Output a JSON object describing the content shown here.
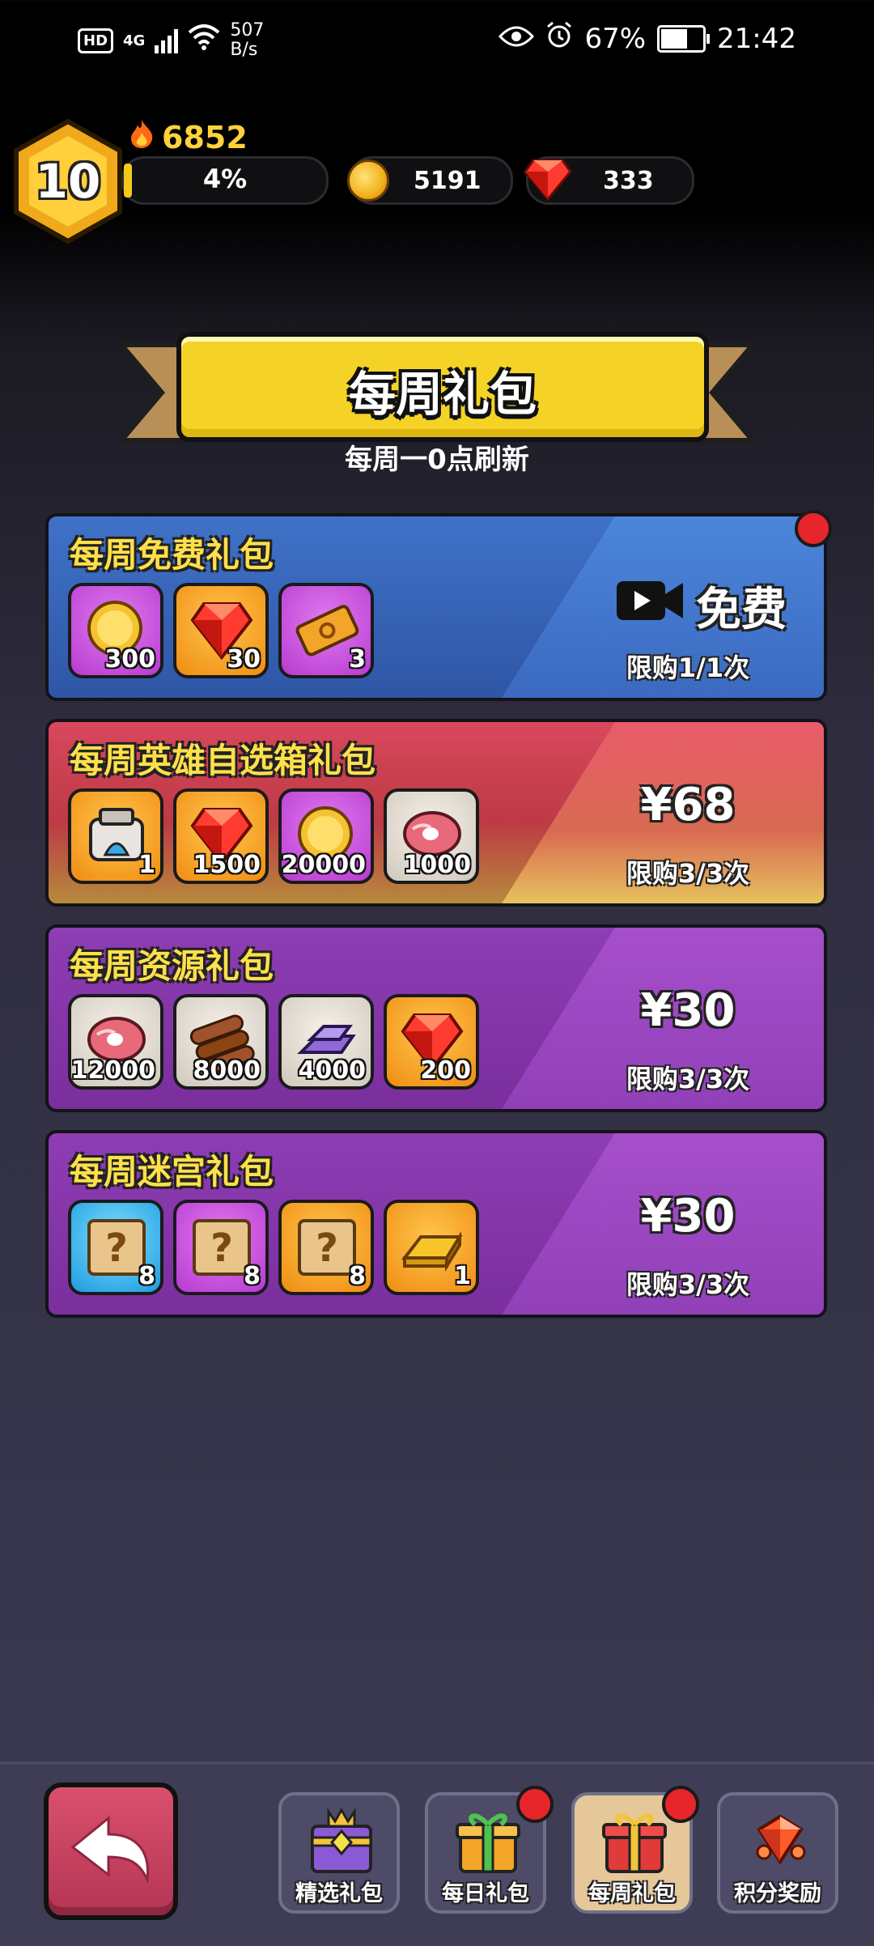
{
  "status_bar": {
    "hd": "HD",
    "network": "4G",
    "net_speed_value": "507",
    "net_speed_unit": "B/s",
    "battery": "67%",
    "time": "21:42"
  },
  "player": {
    "level": "10",
    "power": "6852",
    "exp_percent": "4%",
    "exp_fraction": 0.04,
    "coins": "5191",
    "gems": "333"
  },
  "header": {
    "title": "每周礼包",
    "subtitle": "每周一0点刷新"
  },
  "packs": [
    {
      "title": "每周免费礼包",
      "items": [
        {
          "icon": "gold-coin-icon",
          "qty": "300"
        },
        {
          "icon": "red-gem-icon",
          "qty": "30"
        },
        {
          "icon": "ticket-icon",
          "qty": "3"
        }
      ],
      "action_label": "免费",
      "action_icon": "video-camera-icon",
      "limit": "限购1/1次"
    },
    {
      "title": "每周英雄自选箱礼包",
      "items": [
        {
          "icon": "hero-chest-icon",
          "qty": "1"
        },
        {
          "icon": "red-gem-icon",
          "qty": "1500"
        },
        {
          "icon": "gold-coin-icon",
          "qty": "20000"
        },
        {
          "icon": "meat-icon",
          "qty": "1000"
        }
      ],
      "price": "¥68",
      "limit": "限购3/3次"
    },
    {
      "title": "每周资源礼包",
      "items": [
        {
          "icon": "meat-icon",
          "qty": "12000"
        },
        {
          "icon": "wood-logs-icon",
          "qty": "8000"
        },
        {
          "icon": "iron-ingot-icon",
          "qty": "4000"
        },
        {
          "icon": "red-gem-icon",
          "qty": "200"
        }
      ],
      "price": "¥30",
      "limit": "限购3/3次"
    },
    {
      "title": "每周迷宫礼包",
      "items": [
        {
          "icon": "mystery-map-icon",
          "qty": "8"
        },
        {
          "icon": "mystery-map-icon",
          "qty": "8"
        },
        {
          "icon": "mystery-map-icon",
          "qty": "8"
        },
        {
          "icon": "gold-bar-icon",
          "qty": "1"
        }
      ],
      "price": "¥30",
      "limit": "限购3/3次"
    }
  ],
  "nav": {
    "back_icon": "back-arrow-icon",
    "tabs": [
      {
        "label": "精选礼包",
        "icon": "featured-chest-icon"
      },
      {
        "label": "每日礼包",
        "icon": "gift-box-icon"
      },
      {
        "label": "每周礼包",
        "icon": "red-gift-box-icon"
      },
      {
        "label": "积分奖励",
        "icon": "gem-cluster-icon"
      }
    ]
  },
  "colors": {
    "gold": "#f4d326",
    "free_card": "#3e6fc4",
    "hero_card": "#cf3f52",
    "purple_card": "#8c3bb0",
    "badge_red": "#e6262a"
  }
}
